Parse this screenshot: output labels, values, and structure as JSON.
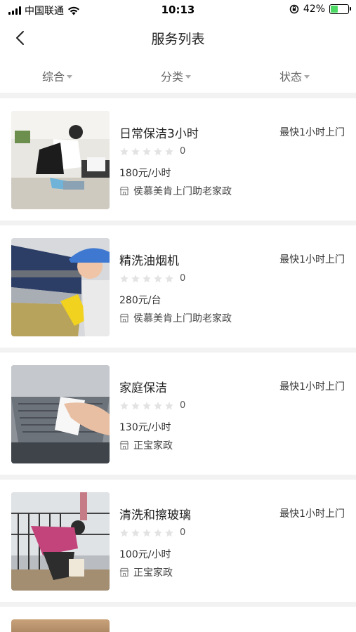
{
  "status_bar": {
    "carrier": "中国联通",
    "time": "10:13",
    "battery": "42%",
    "battery_level": 0.42
  },
  "nav": {
    "title": "服务列表",
    "back_icon": "chevron-left-icon"
  },
  "filters": [
    {
      "label": "综合"
    },
    {
      "label": "分类"
    },
    {
      "label": "状态"
    }
  ],
  "services": [
    {
      "title": "日常保洁3小时",
      "fast": "最快1小时上门",
      "rating": 0,
      "rating_label": "0",
      "price": "180元/小时",
      "shop": "侯慕美肯上门助老家政"
    },
    {
      "title": "精洗油烟机",
      "fast": "最快1小时上门",
      "rating": 0,
      "rating_label": "0",
      "price": "280元/台",
      "shop": "侯慕美肯上门助老家政"
    },
    {
      "title": "家庭保洁",
      "fast": "最快1小时上门",
      "rating": 0,
      "rating_label": "0",
      "price": "130元/小时",
      "shop": "正宝家政"
    },
    {
      "title": "清洗和擦玻璃",
      "fast": "最快1小时上门",
      "rating": 0,
      "rating_label": "0",
      "price": "100元/小时",
      "shop": "正宝家政"
    }
  ],
  "colors": {
    "star_empty": "#e3e3e3",
    "battery_fill": "#4cd964",
    "divider": "#f2f2f2"
  }
}
